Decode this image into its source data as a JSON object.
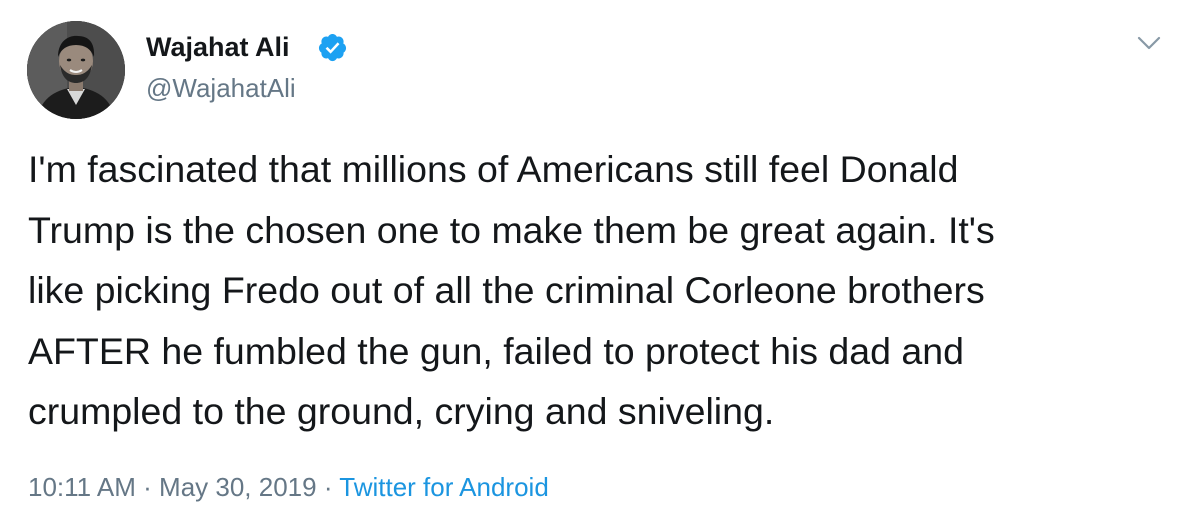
{
  "author": {
    "display_name": "Wajahat Ali",
    "handle": "@WajahatAli",
    "verified": true,
    "avatar_icon": "profile-photo"
  },
  "tweet": {
    "text": "I'm fascinated that millions of Americans still feel Donald\nTrump is the chosen one to make them be great again. It's\nlike picking Fredo out of all the criminal Corleone brothers\nAFTER he fumbled the gun, failed to protect his dad and\ncrumpled to the ground, crying and sniveling."
  },
  "meta": {
    "time": "10:11 AM",
    "separator": " · ",
    "date": "May 30, 2019",
    "source": "Twitter for Android"
  },
  "icons": {
    "verified": "verified-badge-icon",
    "menu": "chevron-down-icon"
  },
  "colors": {
    "text": "#14171a",
    "secondary": "#657786",
    "link": "#1b95e0",
    "verified": "#1da1f2"
  }
}
